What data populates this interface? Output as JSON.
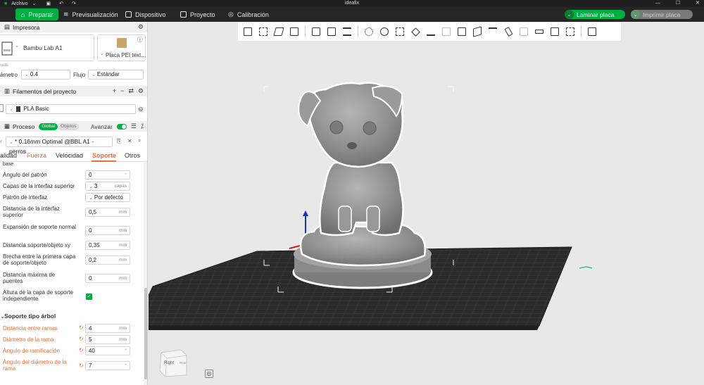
{
  "titlebar": {
    "file_menu": "Archivo",
    "title": "ideafix"
  },
  "nav": {
    "tabs": [
      {
        "label": "Preparar",
        "icon": "home-icon"
      },
      {
        "label": "Previsualización",
        "icon": "layers-icon"
      },
      {
        "label": "Dispositivo",
        "icon": "device-icon"
      },
      {
        "label": "Proyecto",
        "icon": "project-icon"
      },
      {
        "label": "Calibración",
        "icon": "calibration-icon"
      }
    ],
    "slice_label": "Laminar placa",
    "print_label": "Imprimir placa"
  },
  "printer": {
    "section_title": "Impresora",
    "name": "Bambu Lab A1",
    "plate_name": "Placa PEI text...",
    "nozzle_label": "ámetro",
    "nozzle_value": "0.4",
    "flow_label": "Flujo",
    "flow_value": "Estándar",
    "sub_label": "quilla"
  },
  "filaments": {
    "section_title": "Filamentos del proyecto",
    "item": "PLA Basic",
    "color": "#3a3a3a"
  },
  "process": {
    "section_title": "Proceso",
    "mode_global": "Global",
    "mode_objects": "Objetos",
    "advanced_label": "Avanzar",
    "preset": "* 0.16mm Optimal @BBL A1 - perros",
    "tabs": [
      "alidad",
      "Fuerza",
      "Velocidad",
      "Soporte",
      "Otros"
    ],
    "active_tab": "Soporte"
  },
  "settings": {
    "top_cut": "base",
    "rows": [
      {
        "label": "Ángulo del patrón",
        "value": "0",
        "unit": "°"
      },
      {
        "label": "Capas de la interfaz superior",
        "value": "3",
        "unit": "capas"
      },
      {
        "label": "Patrón de interfaz",
        "value": "Por defecto",
        "unit": ""
      },
      {
        "label": "Distancia de la interfaz superior",
        "value": "0,5",
        "unit": "mm"
      },
      {
        "label": "Expansión de soporte normal",
        "value": "0",
        "unit": "mm"
      },
      {
        "label": "Distancia soporte/objeto xy",
        "value": "0,35",
        "unit": "mm"
      },
      {
        "label": "Brecha entre la primera capa de soporte/objeto",
        "value": "0,2",
        "unit": "mm"
      },
      {
        "label": "Distancia máxima de puentes",
        "value": "0",
        "unit": "mm"
      },
      {
        "label": "Altura de la capa de soporte independiente",
        "value": "",
        "unit": ""
      }
    ],
    "tree_title": "Soporte tipo árbol",
    "tree_rows": [
      {
        "label": "Distancia entre ramas",
        "value": "4",
        "unit": "mm"
      },
      {
        "label": "Diámetro de la rama",
        "value": "5",
        "unit": "mm"
      },
      {
        "label": "Ángulo de ramificación",
        "value": "40",
        "unit": "°"
      },
      {
        "label": "Ángulo del diámetro de la rama",
        "value": "7",
        "unit": "°"
      }
    ]
  },
  "viewport": {
    "cube_face": "Right",
    "cube_face_side": "Rear",
    "accent": "#00ae42",
    "bed_color": "#2b2b2b",
    "model_color": "#8f8f8f"
  }
}
